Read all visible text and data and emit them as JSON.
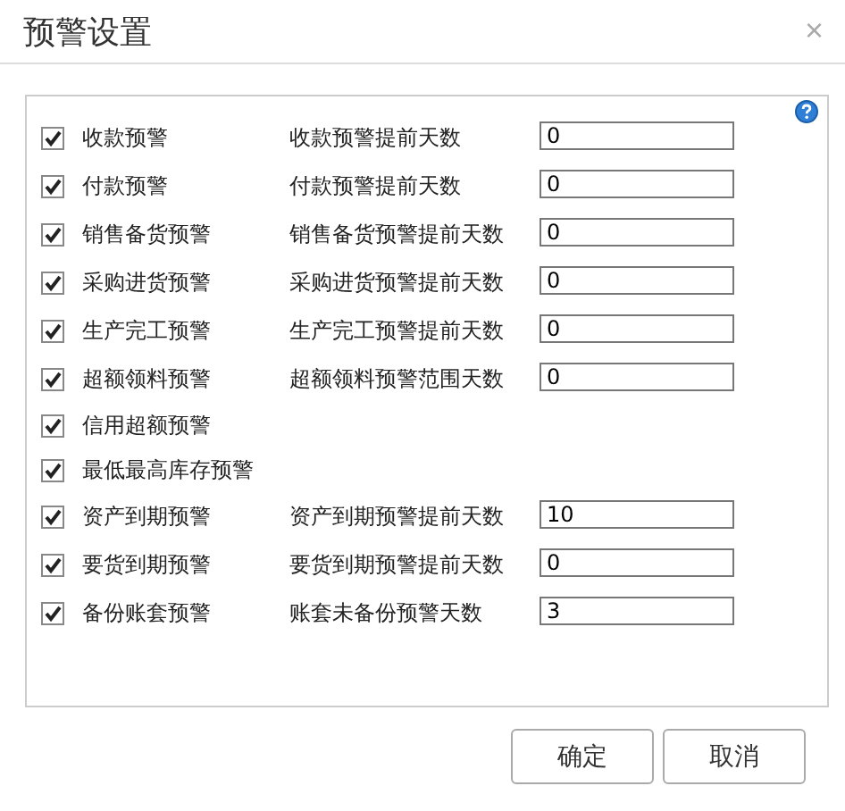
{
  "window": {
    "title": "预警设置",
    "close": "×"
  },
  "rows": [
    {
      "label": "收款预警",
      "checked": true,
      "days_label": "收款预警提前天数",
      "value": "0"
    },
    {
      "label": "付款预警",
      "checked": true,
      "days_label": "付款预警提前天数",
      "value": "0"
    },
    {
      "label": "销售备货预警",
      "checked": true,
      "days_label": "销售备货预警提前天数",
      "value": "0"
    },
    {
      "label": "采购进货预警",
      "checked": true,
      "days_label": "采购进货预警提前天数",
      "value": "0"
    },
    {
      "label": "生产完工预警",
      "checked": true,
      "days_label": "生产完工预警提前天数",
      "value": "0"
    },
    {
      "label": "超额领料预警",
      "checked": true,
      "days_label": "超额领料预警范围天数",
      "value": "0"
    },
    {
      "label": "信用超额预警",
      "checked": true
    },
    {
      "label": "最低最高库存预警",
      "checked": true
    },
    {
      "label": "资产到期预警",
      "checked": true,
      "days_label": "资产到期预警提前天数",
      "value": "10"
    },
    {
      "label": "要货到期预警",
      "checked": true,
      "days_label": "要货到期预警提前天数",
      "value": "0"
    },
    {
      "label": "备份账套预警",
      "checked": true,
      "days_label": "账套未备份预警天数",
      "value": "3"
    }
  ],
  "buttons": [
    "确定",
    "取消"
  ]
}
